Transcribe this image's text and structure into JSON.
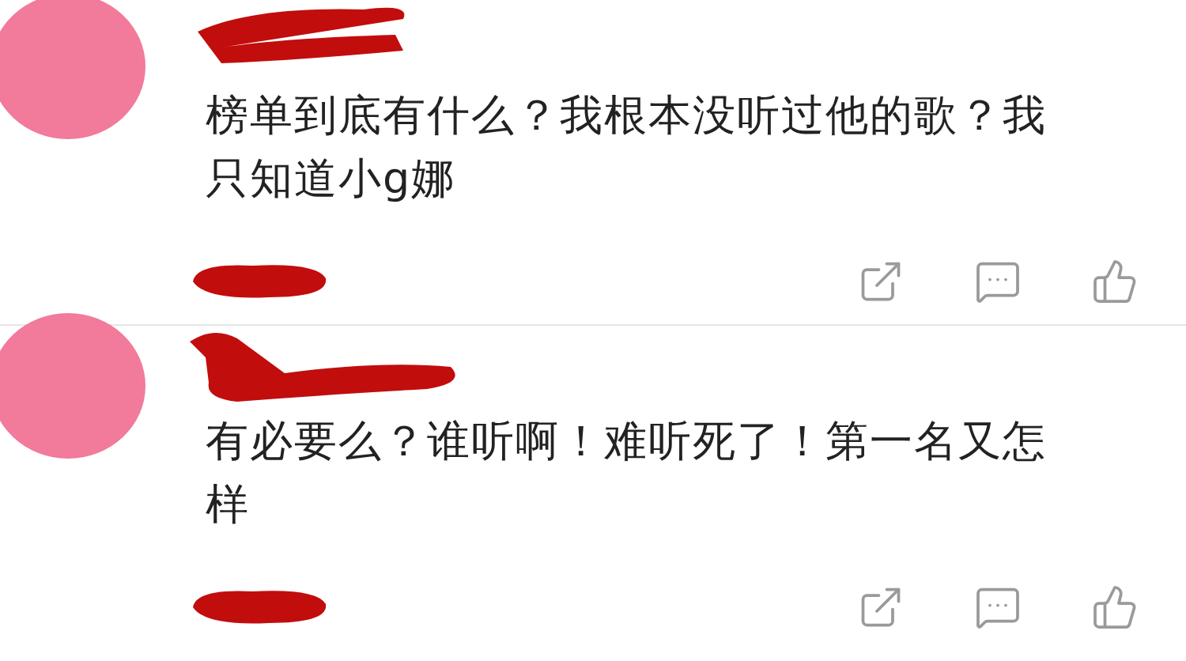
{
  "comments": [
    {
      "text": "榜单到底有什么？我根本没听过他的歌？我只知道小g娜"
    },
    {
      "text": "有必要么？谁听啊！难听死了！第一名又怎样"
    }
  ]
}
